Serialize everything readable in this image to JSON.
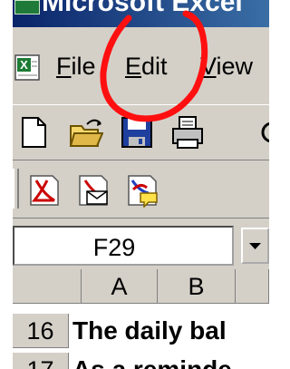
{
  "titlebar": {
    "title": "Microsoft Excel",
    "icon": "excel-app-icon"
  },
  "menubar": {
    "items": [
      {
        "label": "File",
        "accel": "F",
        "rest": "ile"
      },
      {
        "label": "Edit",
        "accel": "E",
        "rest": "dit"
      },
      {
        "label": "View",
        "accel": "V",
        "rest": "iew"
      }
    ]
  },
  "toolbar_standard": {
    "icons": [
      "new-document-icon",
      "open-folder-icon",
      "save-disk-icon",
      "print-icon",
      "more-icon"
    ]
  },
  "toolbar_pdf": {
    "icons": [
      "convert-to-pdf-icon",
      "convert-and-email-pdf-icon",
      "convert-and-send-for-review-icon"
    ]
  },
  "formula_bar": {
    "name_box_value": "F29"
  },
  "sheet": {
    "columns": [
      "A",
      "B"
    ],
    "rows": [
      {
        "number": "16",
        "text": "The daily bal"
      },
      {
        "number": "17",
        "text": "As a reminde"
      }
    ]
  },
  "colors": {
    "titlebar": "#0a246a",
    "chrome": "#d4d0c8",
    "annotation": "#ff0000",
    "pdf_red": "#cc0000"
  }
}
